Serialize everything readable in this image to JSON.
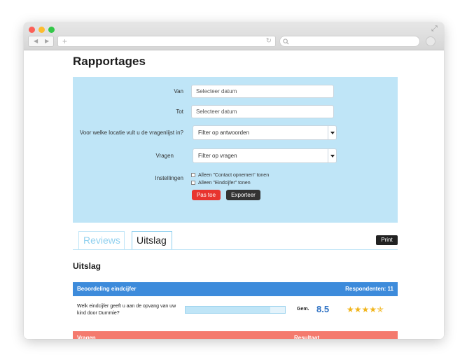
{
  "page": {
    "title": "Rapportages"
  },
  "filters": {
    "van_label": "Van",
    "van_placeholder": "Selecteer datum",
    "tot_label": "Tot",
    "tot_placeholder": "Selecteer datum",
    "locatie_label": "Voor welke locatie vult u de vragenlijst in?",
    "locatie_value": "Filter op antwoorden",
    "vragen_label": "Vragen",
    "vragen_value": "Filter op vragen",
    "instellingen_label": "Instellingen",
    "option_contact": "Alleen \"Contact opnemen\" tonen",
    "option_eindcijfer": "Alleen \"Eindcijfer\" tonen",
    "apply_label": "Pas toe",
    "export_label": "Exporteer"
  },
  "tabs": [
    {
      "label": "Reviews",
      "active": false
    },
    {
      "label": "Uitslag",
      "active": true
    }
  ],
  "print_label": "Print",
  "section_title": "Uitslag",
  "result": {
    "header_left": "Beoordeling eindcijfer",
    "header_right": "Respondenten: 11",
    "question": "Welk eindcijfer geeft u aan de opvang van uw kind door Dummie?",
    "progress_percent": 85,
    "gem_label": "Gem.",
    "score": "8.5",
    "stars": "★★★★✯",
    "rating": 4.5,
    "header_color": "#3d8bdb"
  },
  "result2": {
    "header_left": "Vragen",
    "header_right": "Resultaat",
    "header_color": "#f47a6e"
  },
  "colors": {
    "panel": "#bfe5f7",
    "apply": "#e8342f",
    "export": "#333333",
    "score": "#2f72c4",
    "star": "#f1b51c"
  }
}
